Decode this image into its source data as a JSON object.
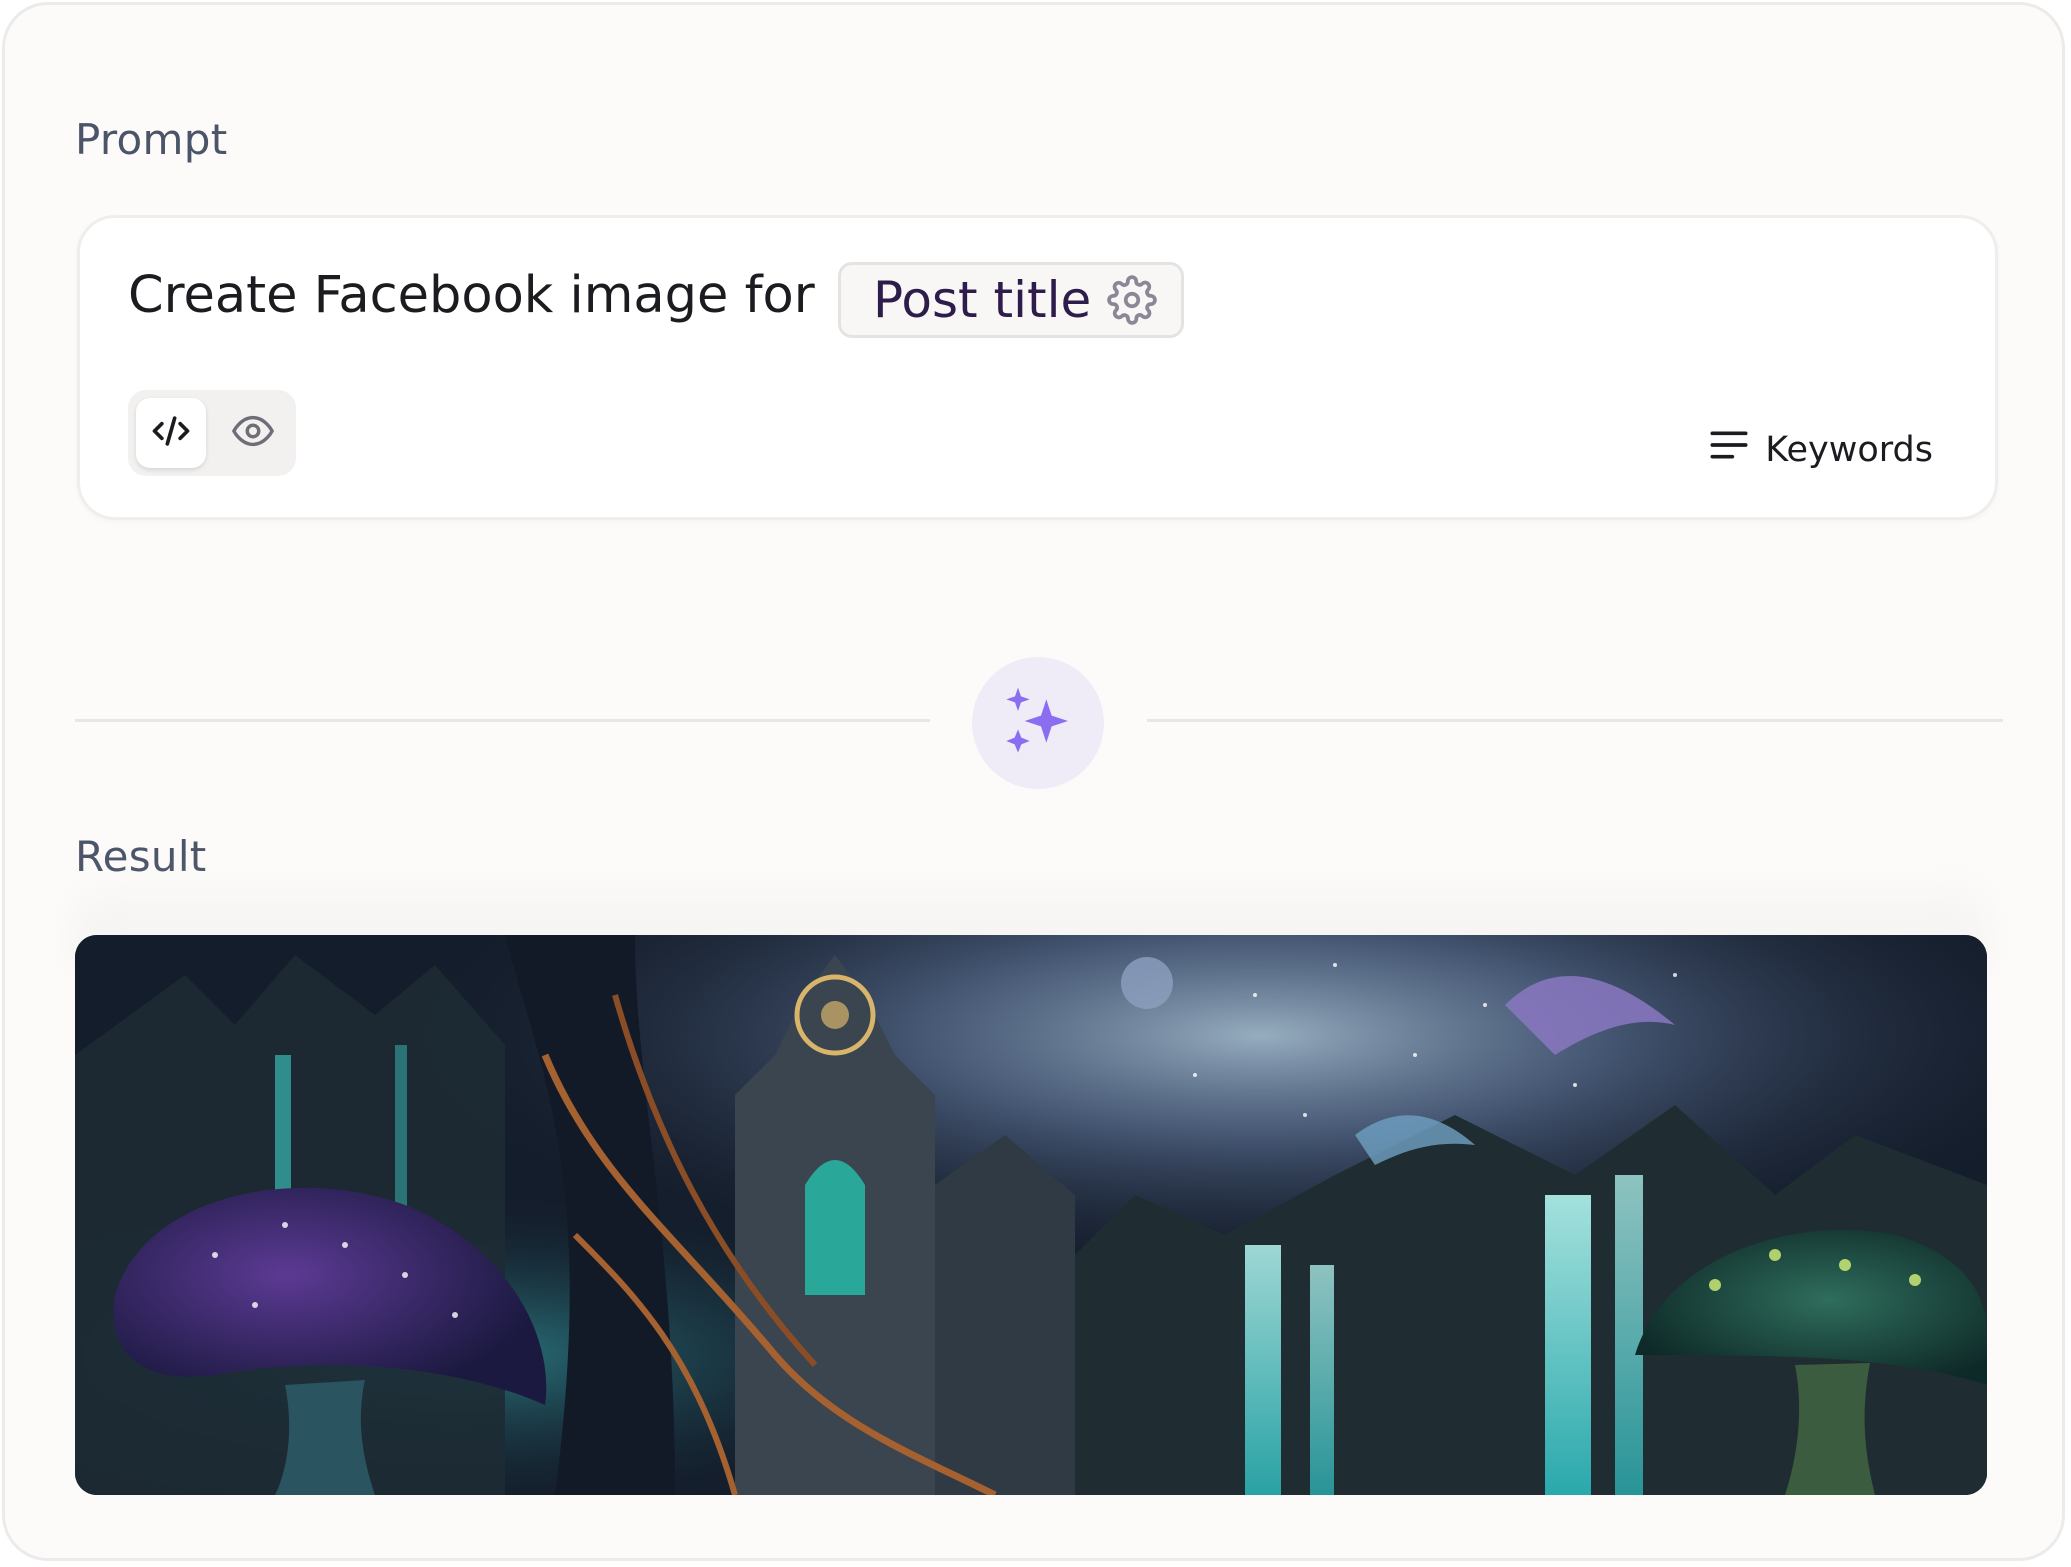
{
  "sections": {
    "prompt_label": "Prompt",
    "result_label": "Result"
  },
  "prompt": {
    "text": "Create Facebook image for",
    "variable_chip": {
      "label": "Post title",
      "icon": "gear-icon"
    }
  },
  "toolbar": {
    "code_view_icon": "code-icon",
    "preview_icon": "eye-icon",
    "keywords_label": "Keywords",
    "keywords_icon": "lines-icon"
  },
  "generate": {
    "icon": "sparkles-icon"
  },
  "colors": {
    "accent": "#7b63e8",
    "chip_text": "#2e1d4b",
    "label_text": "#4b5468",
    "generate_bg": "#efecf8"
  }
}
